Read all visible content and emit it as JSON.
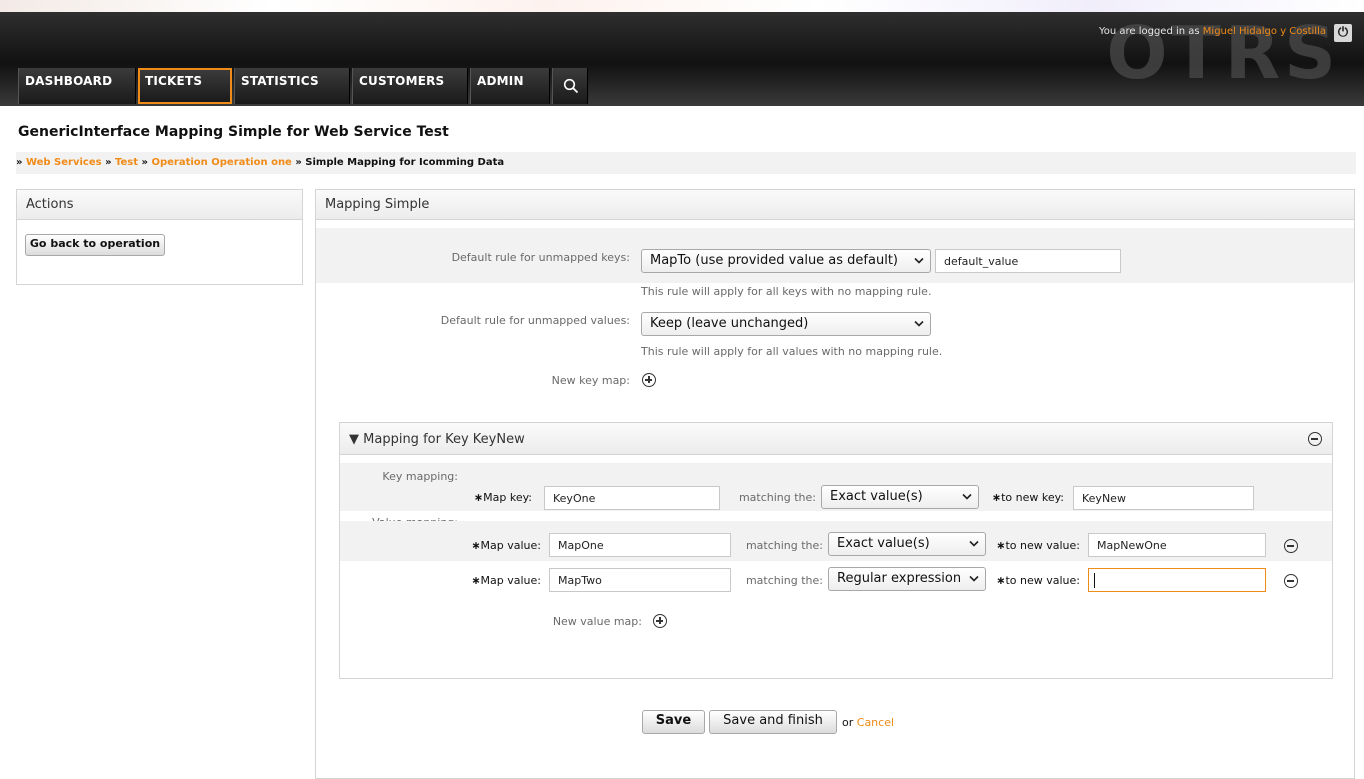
{
  "header": {
    "logo_text": "OTRS",
    "login_prefix": "You are logged in as",
    "user_name": "Miguel Hidalgo y Costilla",
    "logout_icon": "power-icon",
    "nav": [
      "DASHBOARD",
      "TICKETS",
      "STATISTICS",
      "CUSTOMERS",
      "ADMIN"
    ],
    "active_nav": "TICKETS",
    "search_icon": "search-icon",
    "accent_color": "#f08b18"
  },
  "page": {
    "title": "GenericInterface Mapping Simple for Web Service Test",
    "breadcrumb": {
      "sep": "»",
      "crumb1": "Web Services",
      "crumb2": "Test",
      "crumb3": "Operation Operation one",
      "current": "Simple Mapping for Icomming Data"
    }
  },
  "sidebar": {
    "title": "Actions",
    "back_button": "Go back to operation"
  },
  "main": {
    "title": "Mapping Simple",
    "default_keys_label": "Default rule for unmapped keys:",
    "default_keys_select": "MapTo (use provided value as default)",
    "default_keys_value": "default_value",
    "default_keys_hint": "This rule will apply for all keys with no mapping rule.",
    "default_values_label": "Default rule for unmapped values:",
    "default_values_select": "Keep (leave unchanged)",
    "default_values_hint": "This rule will apply for all values with no mapping rule.",
    "new_key_map_label": "New key map:"
  },
  "key_map": {
    "title": "Mapping for Key KeyNew",
    "toggle": "▼",
    "key_section_label": "Key mapping:",
    "map_key_label": "Map key:",
    "map_key_value": "KeyOne",
    "matching_label": "matching the:",
    "key_match_select": "Exact value(s)",
    "to_new_key_label": "to new key:",
    "new_key_value": "KeyNew",
    "value_section_label": "Value mapping:",
    "required_mark": "∗",
    "value_rows": [
      {
        "map_value_label": "Map value:",
        "map_value": "MapOne",
        "matching_label": "matching the:",
        "match_type": "Exact value(s)",
        "to_new_value_label": "to new value:",
        "new_value": "MapNewOne"
      },
      {
        "map_value_label": "Map value:",
        "map_value": "MapTwo",
        "matching_label": "matching the:",
        "match_type": "Regular expression",
        "to_new_value_label": "to new value:",
        "new_value": ""
      }
    ],
    "new_value_map_label": "New value map:"
  },
  "actions": {
    "save": "Save",
    "save_finish": "Save and finish",
    "or": "or",
    "cancel": "Cancel"
  }
}
